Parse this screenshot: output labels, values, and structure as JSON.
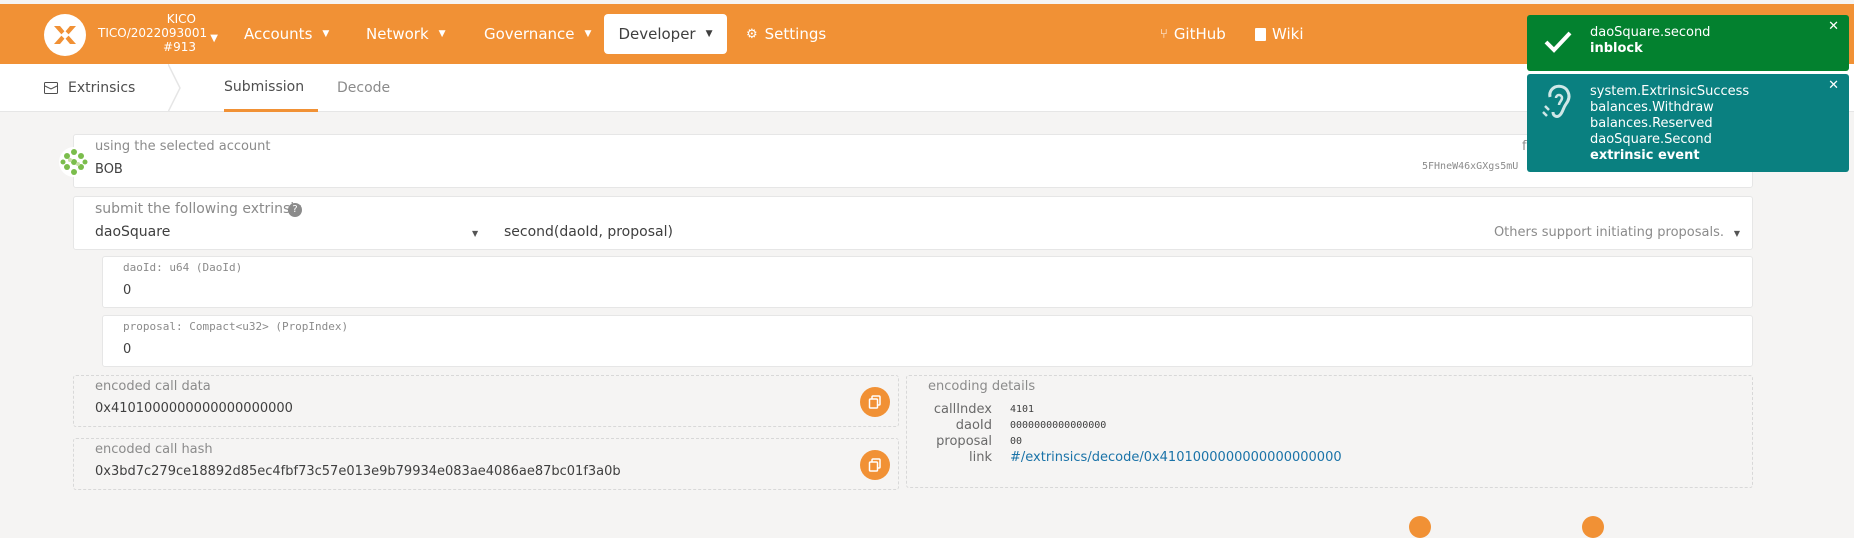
{
  "header": {
    "chain_name": "KICO",
    "chain_version": "TICO/2022093001",
    "block": "#913",
    "nav": [
      {
        "label": "Accounts"
      },
      {
        "label": "Network"
      },
      {
        "label": "Governance"
      },
      {
        "label": "Developer"
      },
      {
        "label": "Settings"
      }
    ],
    "github": "GitHub",
    "wiki": "Wiki"
  },
  "subnav": {
    "section": "Extrinsics",
    "tabs": [
      {
        "label": "Submission"
      },
      {
        "label": "Decode"
      }
    ]
  },
  "account": {
    "label": "using the selected account",
    "name": "BOB",
    "free_label": "f",
    "address": "5FHneW46xGXgs5mU"
  },
  "extrinsic": {
    "label": "submit the following extrinsic",
    "help_icon": "?",
    "module": "daoSquare",
    "method": "second(daoId, proposal)",
    "description": "Others support initiating proposals."
  },
  "params": [
    {
      "label": "daoId: u64 (DaoId)",
      "value": "0"
    },
    {
      "label": "proposal: Compact<u32> (PropIndex)",
      "value": "0"
    }
  ],
  "encoded": {
    "call_data_label": "encoded call data",
    "call_data": "0x4101000000000000000000",
    "call_hash_label": "encoded call hash",
    "call_hash": "0x3bd7c279ce18892d85ec4fbf73c57e013e9b79934e083ae4086ae87bc01f3a0b"
  },
  "encoding_details": {
    "title": "encoding details",
    "rows": [
      {
        "key": "callIndex",
        "value": "4101"
      },
      {
        "key": "daoId",
        "value": "0000000000000000"
      },
      {
        "key": "proposal",
        "value": "00"
      },
      {
        "key": "link",
        "value": "#/extrinsics/decode/0x4101000000000000000000"
      }
    ]
  },
  "toasts": [
    {
      "lines": [
        "daoSquare.second"
      ],
      "status": "inblock",
      "color": "#03812f"
    },
    {
      "lines": [
        "system.ExtrinsicSuccess",
        "balances.Withdraw",
        "balances.Reserved",
        "daoSquare.Second"
      ],
      "status": "extrinsic event",
      "color": "#0a8080"
    }
  ],
  "colors": {
    "accent": "#f19135",
    "link": "#1a73a8"
  }
}
